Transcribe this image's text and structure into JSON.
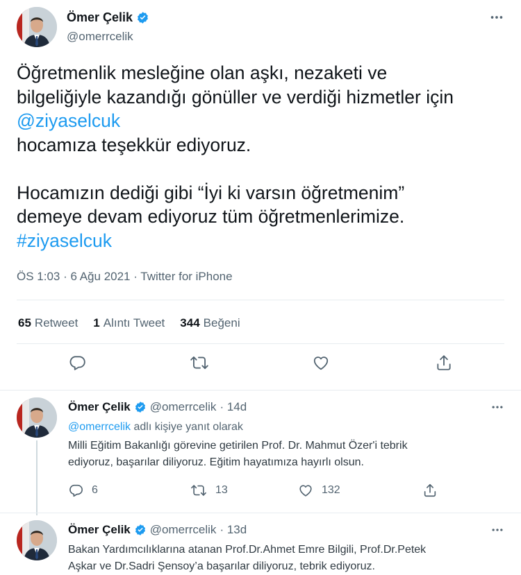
{
  "main_tweet": {
    "author_name": "Ömer Çelik",
    "author_handle": "@omerrcelik",
    "text_lines": [
      "Öğretmenlik mesleğine olan aşkı, nezaketi ve",
      "bilgeliğiyle kazandığı gönüller ve verdiği hizmetler için",
      "@ziyaselcuk",
      "hocamıza teşekkür ediyoruz.",
      "Hocamızın dediği gibi “İyi ki varsın öğretmenim”",
      "demeye devam ediyoruz tüm öğretmenlerimize.",
      "#ziyaselcuk"
    ],
    "meta": "ÖS 1:03 · 6 Ağu 2021 · Twitter for iPhone",
    "stats": {
      "retweet_count": "65",
      "retweet_label": "Retweet",
      "quote_count": "1",
      "quote_label": "Alıntı Tweet",
      "like_count": "344",
      "like_label": "Beğeni"
    },
    "actions": [
      "reply-icon",
      "retweet-icon",
      "like-icon",
      "share-icon"
    ]
  },
  "replies": [
    {
      "author_name": "Ömer Çelik",
      "author_handle": "@omerrcelik",
      "time": "· 14d",
      "replying_handle": "@omerrcelik",
      "replying_suffix": " adlı kişiye yanıt olarak",
      "text_lines": [
        "Milli Eğitim Bakanlığı görevine getirilen Prof. Dr. Mahmut Özer'i tebrik",
        "ediyoruz, başarılar diliyoruz. Eğitim hayatımıza hayırlı olsun."
      ],
      "reply_count": "6",
      "retweet_count": "13",
      "like_count": "132"
    },
    {
      "author_name": "Ömer Çelik",
      "author_handle": "@omerrcelik",
      "time": "· 13d",
      "text_lines": [
        "Bakan Yardımcılıklarına atanan Prof.Dr.Ahmet Emre Bilgili, Prof.Dr.Petek",
        "Aşkar ve Dr.Sadri Şensoy’a başarılar diliyoruz, tebrik ediyoruz."
      ]
    }
  ],
  "colors": {
    "accent": "#1d9bf0",
    "text": "#0f1419",
    "muted": "#536471",
    "divider": "#e7ecf0"
  }
}
